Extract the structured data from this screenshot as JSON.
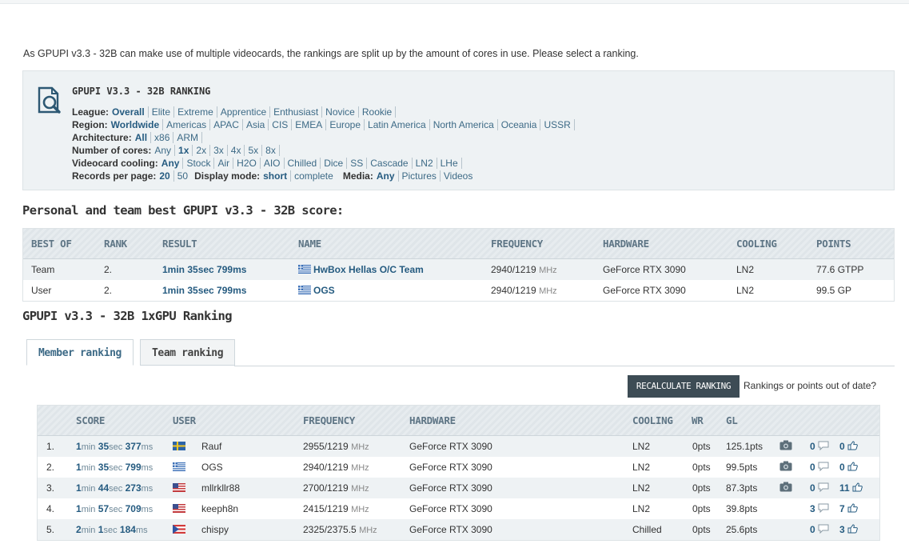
{
  "intro": "As GPUPI v3.3 - 32B can make use of multiple videocards, the rankings are split up by the amount of cores in use. Please select a ranking.",
  "filter_panel": {
    "title": "GPUPI V3.3 - 32B RANKING",
    "rows": [
      {
        "label": "League:",
        "options": [
          "Overall",
          "Elite",
          "Extreme",
          "Apprentice",
          "Enthusiast",
          "Novice",
          "Rookie"
        ],
        "selected": "Overall"
      },
      {
        "label": "Region:",
        "options": [
          "Worldwide",
          "Americas",
          "APAC",
          "Asia",
          "CIS",
          "EMEA",
          "Europe",
          "Latin America",
          "North America",
          "Oceania",
          "USSR"
        ],
        "selected": "Worldwide"
      },
      {
        "label": "Architecture:",
        "options": [
          "All",
          "x86",
          "ARM"
        ],
        "selected": "All"
      },
      {
        "label": "Number of cores:",
        "options": [
          "Any",
          "1x",
          "2x",
          "3x",
          "4x",
          "5x",
          "8x"
        ],
        "selected": "1x"
      },
      {
        "label": "Videocard cooling:",
        "options": [
          "Any",
          "Stock",
          "Air",
          "H2O",
          "AIO",
          "Chilled",
          "Dice",
          "SS",
          "Cascade",
          "LN2",
          "LHe"
        ],
        "selected": "Any"
      }
    ],
    "records_label": "Records per page:",
    "records_options": [
      "20",
      "50"
    ],
    "records_selected": "20",
    "display_label": "Display mode:",
    "display_options": [
      "short",
      "complete"
    ],
    "display_selected": "short",
    "media_label": "Media:",
    "media_options": [
      "Any",
      "Pictures",
      "Videos"
    ],
    "media_selected": "Any"
  },
  "personal_heading": "Personal and team best GPUPI v3.3 - 32B score:",
  "personal_table": {
    "headers": [
      "BEST OF",
      "RANK",
      "RESULT",
      "NAME",
      "FREQUENCY",
      "HARDWARE",
      "COOLING",
      "POINTS"
    ],
    "rows": [
      {
        "best_of": "Team",
        "rank": "2.",
        "result": "1min 35sec 799ms",
        "name": "HwBox Hellas O/C Team",
        "flag": "greece",
        "freq": "2940/1219",
        "freq_unit": "MHz",
        "hardware": "GeForce RTX 3090",
        "cooling": "LN2",
        "points": "77.6 GTPP"
      },
      {
        "best_of": "User",
        "rank": "2.",
        "result": "1min 35sec 799ms",
        "name": "OGS",
        "flag": "greece",
        "freq": "2940/1219",
        "freq_unit": "MHz",
        "hardware": "GeForce RTX 3090",
        "cooling": "LN2",
        "points": "99.5 GP"
      }
    ]
  },
  "ranking_heading": "GPUPI v3.3 - 32B 1xGPU Ranking",
  "tabs": [
    "Member ranking",
    "Team ranking"
  ],
  "recalc_button": "RECALCULATE RANKING",
  "recalc_note": "Rankings or points out of date?",
  "ranking_table": {
    "headers": [
      "SCORE",
      "USER",
      "FREQUENCY",
      "HARDWARE",
      "COOLING",
      "WR",
      "GL"
    ],
    "rows": [
      {
        "pos": "1.",
        "min": "1",
        "sec": "35",
        "ms": "377",
        "user": "Rauf",
        "flag": "sweden",
        "freq": "2955/1219",
        "freq_unit": "MHz",
        "hardware": "GeForce RTX 3090",
        "cooling": "LN2",
        "wr": "0pts",
        "gl": "125.1pts",
        "camera": true,
        "comments": "0",
        "likes": "0"
      },
      {
        "pos": "2.",
        "min": "1",
        "sec": "35",
        "ms": "799",
        "user": "OGS",
        "flag": "greece",
        "freq": "2940/1219",
        "freq_unit": "MHz",
        "hardware": "GeForce RTX 3090",
        "cooling": "LN2",
        "wr": "0pts",
        "gl": "99.5pts",
        "camera": true,
        "comments": "0",
        "likes": "0"
      },
      {
        "pos": "3.",
        "min": "1",
        "sec": "44",
        "ms": "273",
        "user": "mllrkllr88",
        "flag": "usa",
        "freq": "2700/1219",
        "freq_unit": "MHz",
        "hardware": "GeForce RTX 3090",
        "cooling": "LN2",
        "wr": "0pts",
        "gl": "87.3pts",
        "camera": true,
        "comments": "0",
        "likes": "11"
      },
      {
        "pos": "4.",
        "min": "1",
        "sec": "57",
        "ms": "709",
        "user": "keeph8n",
        "flag": "usa",
        "freq": "2415/1219",
        "freq_unit": "MHz",
        "hardware": "GeForce RTX 3090",
        "cooling": "LN2",
        "wr": "0pts",
        "gl": "39.8pts",
        "camera": false,
        "comments": "3",
        "likes": "7"
      },
      {
        "pos": "5.",
        "min": "2",
        "sec": "1",
        "ms": "184",
        "user": "chispy",
        "flag": "puerto-rico",
        "freq": "2325/2375.5",
        "freq_unit": "MHz",
        "hardware": "GeForce RTX 3090",
        "cooling": "Chilled",
        "wr": "0pts",
        "gl": "25.6pts",
        "camera": false,
        "comments": "0",
        "likes": "3"
      }
    ],
    "unit_min": "min",
    "unit_sec": "sec",
    "unit_ms": "ms"
  }
}
